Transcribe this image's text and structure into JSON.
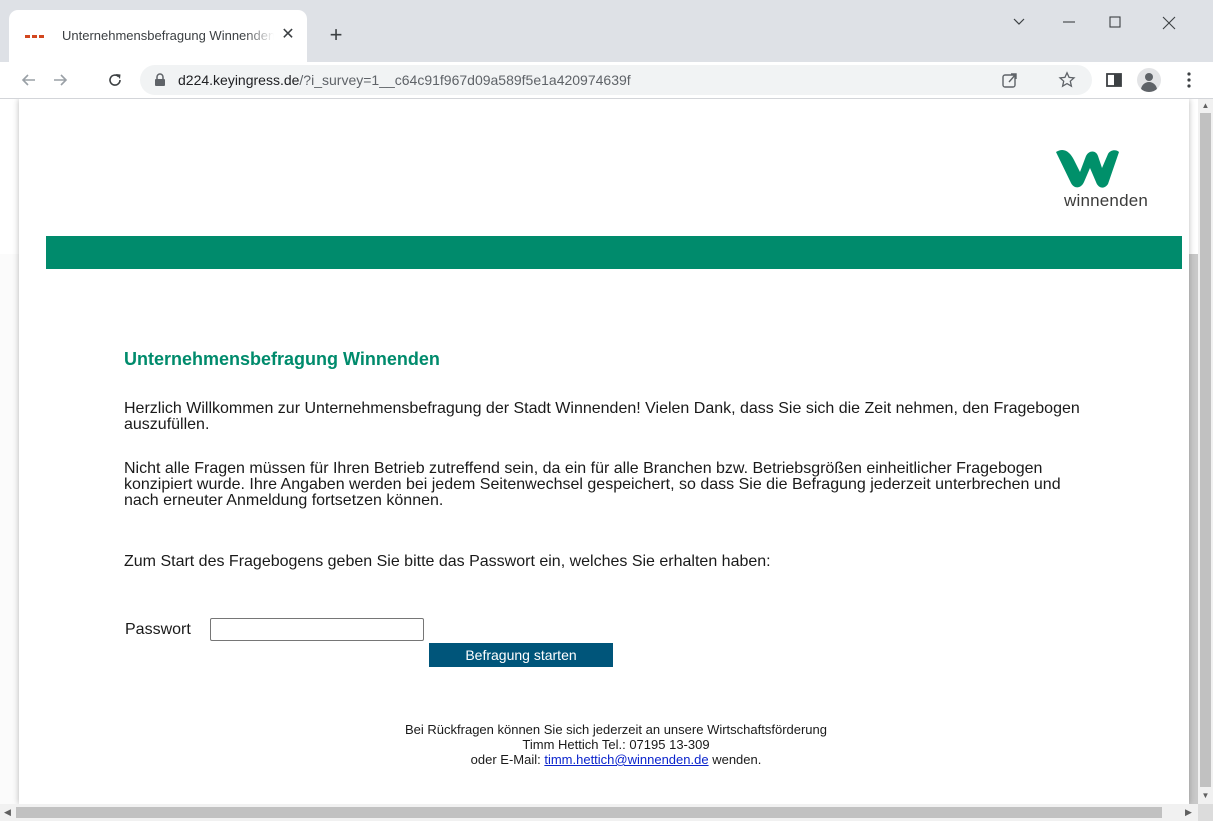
{
  "browser": {
    "tab_title": "Unternehmensbefragung Winnenden",
    "new_tab_label": "+",
    "close_tab_label": "✕",
    "url_host": "d224.keyingress.de",
    "url_path": "/?i_survey=1__c64c91f967d09a589f5e1a420974639f"
  },
  "brand": {
    "logo_text": "winnenden",
    "logo_color": "#00906a",
    "band_color": "#008b6c",
    "heading_color": "#008b6c",
    "button_color": "#00557a"
  },
  "page": {
    "heading": "Unternehmensbefragung Winnenden",
    "paragraph1": "Herzlich Willkommen zur Unternehmensbefragung der Stadt Winnenden! Vielen Dank, dass Sie sich die Zeit nehmen, den Fragebogen auszufüllen.",
    "paragraph2": "Nicht alle Fragen müssen für Ihren Betrieb zutreffend sein, da ein für alle Branchen bzw. Betriebsgrößen einheitlicher Fragebogen konzipiert wurde. Ihre Angaben werden bei jedem Seitenwechsel gespeichert, so dass Sie die Befragung jederzeit unterbrechen und nach erneuter Anmeldung fortsetzen können.",
    "paragraph3": "Zum Start des Fragebogens geben Sie bitte das Passwort ein, welches Sie erhalten haben:",
    "password_label": "Passwort",
    "password_value": "",
    "start_button": "Befragung starten"
  },
  "footer": {
    "line1": "Bei Rückfragen können Sie sich jederzeit an unsere Wirtschaftsförderung",
    "line2": "Timm Hettich Tel.: 07195 13-309",
    "line3_prefix": "oder E-Mail:",
    "email": "timm.hettich@winnenden.de",
    "line3_suffix": "wenden."
  },
  "icons": [
    "favicon",
    "close-icon",
    "new-tab-icon",
    "chevron-down-icon",
    "minimize-icon",
    "maximize-icon",
    "close-window-icon",
    "back-icon",
    "forward-icon",
    "reload-icon",
    "lock-icon",
    "share-icon",
    "star-icon",
    "side-panel-icon",
    "profile-icon",
    "menu-icon"
  ]
}
